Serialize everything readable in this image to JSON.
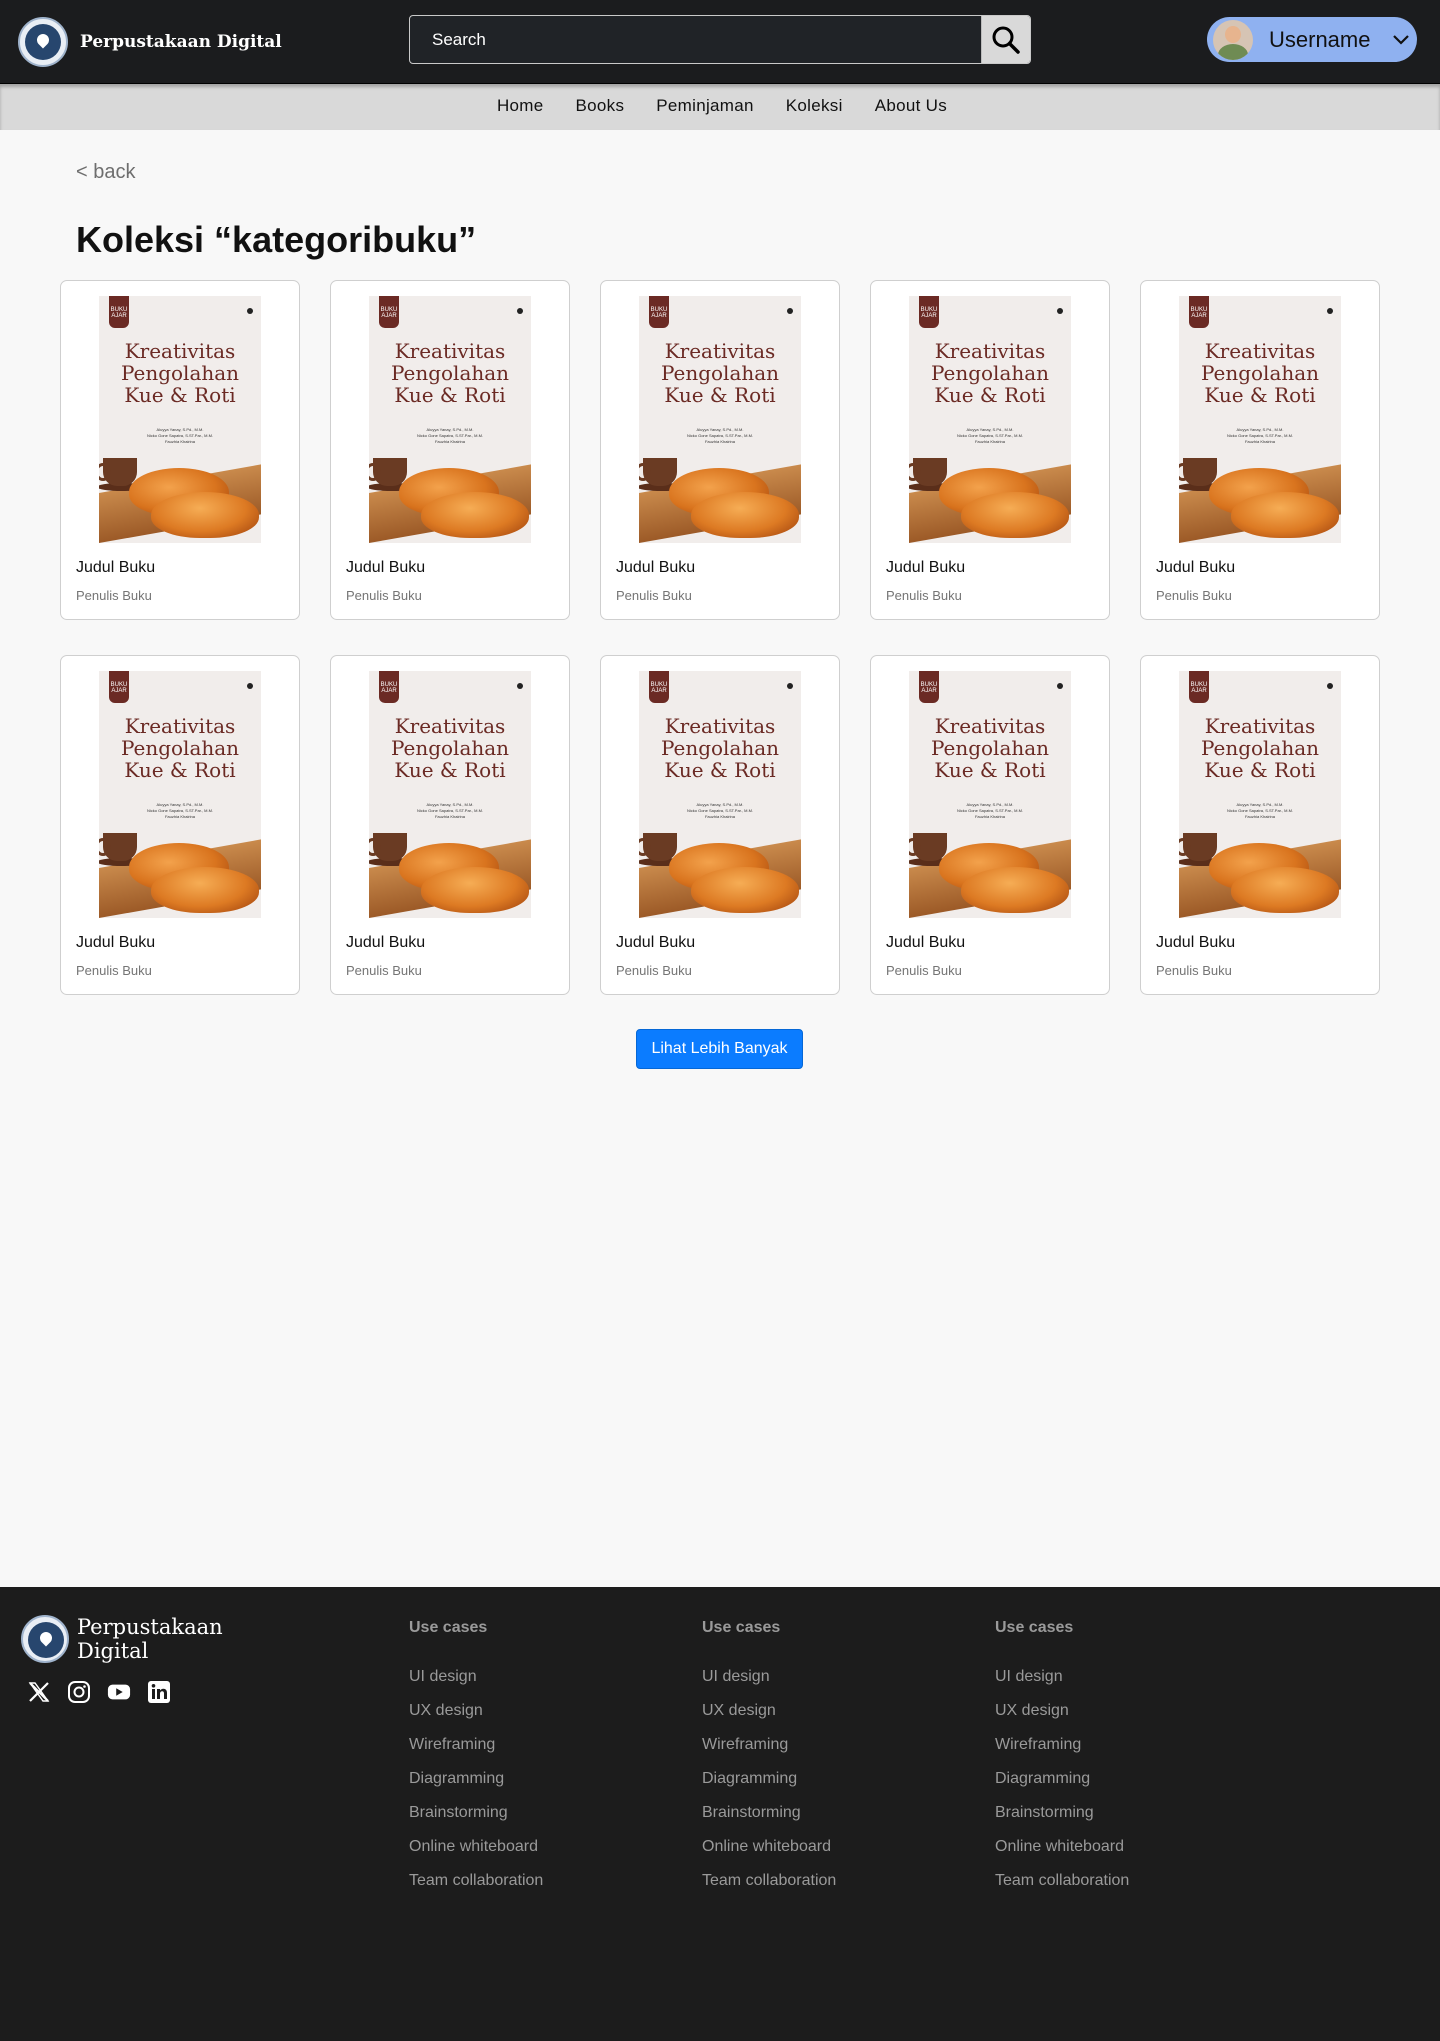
{
  "header": {
    "brand": "Perpustakaan Digital",
    "search_placeholder": "Search",
    "username": "Username"
  },
  "nav": [
    "Home",
    "Books",
    "Peminjaman",
    "Koleksi",
    "About Us"
  ],
  "back_label": "< back",
  "page_title": "Koleksi “kategoribuku”",
  "cover": {
    "tag_line1": "BUKU",
    "tag_line2": "AJAR",
    "title_line1": "Kreativitas",
    "title_line2": "Pengolahan",
    "title_line3": "Kue & Roti",
    "authors": [
      "Aluyya Yanay, S.Pd., M.M.",
      "Nicko Gone Sapatra, S.ST.Par., M.M.",
      "Fauzhia Khairina"
    ]
  },
  "books": [
    {
      "title": "Judul Buku",
      "author": "Penulis Buku"
    },
    {
      "title": "Judul Buku",
      "author": "Penulis Buku"
    },
    {
      "title": "Judul Buku",
      "author": "Penulis Buku"
    },
    {
      "title": "Judul Buku",
      "author": "Penulis Buku"
    },
    {
      "title": "Judul Buku",
      "author": "Penulis Buku"
    },
    {
      "title": "Judul Buku",
      "author": "Penulis Buku"
    },
    {
      "title": "Judul Buku",
      "author": "Penulis Buku"
    },
    {
      "title": "Judul Buku",
      "author": "Penulis Buku"
    },
    {
      "title": "Judul Buku",
      "author": "Penulis Buku"
    },
    {
      "title": "Judul Buku",
      "author": "Penulis Buku"
    }
  ],
  "more_button": "Lihat Lebih Banyak",
  "footer": {
    "brand_line1": "Perpustakaan",
    "brand_line2": "Digital",
    "socials": [
      "x-icon",
      "instagram-icon",
      "youtube-icon",
      "linkedin-icon"
    ],
    "columns": [
      {
        "heading": "Use cases",
        "links": [
          "UI design",
          "UX design",
          "Wireframing",
          "Diagramming",
          "Brainstorming",
          "Online whiteboard",
          "Team collaboration"
        ]
      },
      {
        "heading": "Use cases",
        "links": [
          "UI design",
          "UX design",
          "Wireframing",
          "Diagramming",
          "Brainstorming",
          "Online whiteboard",
          "Team collaboration"
        ]
      },
      {
        "heading": "Use cases",
        "links": [
          "UI design",
          "UX design",
          "Wireframing",
          "Diagramming",
          "Brainstorming",
          "Online whiteboard",
          "Team collaboration"
        ]
      }
    ]
  },
  "colors": {
    "header_bg": "#1b1c1e",
    "nav_bg": "#d9d9d9",
    "accent": "#0b7cff",
    "user_pill": "#8fb1f0",
    "footer_bg": "#1c1c1c",
    "cover_title": "#6b2a24"
  }
}
